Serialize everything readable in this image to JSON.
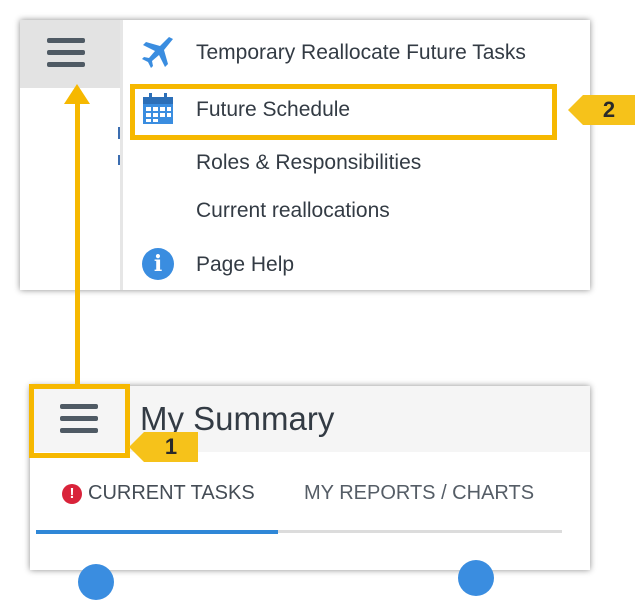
{
  "top_menu": {
    "items": [
      {
        "label": "Temporary Reallocate Future Tasks",
        "icon": "airplane-icon"
      },
      {
        "label": "Future Schedule",
        "icon": "calendar-icon"
      },
      {
        "label": "Roles & Responsibilities",
        "icon": ""
      },
      {
        "label": "Current reallocations",
        "icon": ""
      },
      {
        "label": "Page Help",
        "icon": "info-icon"
      }
    ],
    "info_glyph": "i"
  },
  "summary": {
    "title": "My Summary",
    "tabs": [
      {
        "label": "CURRENT TASKS",
        "active": true,
        "alert_glyph": "!"
      },
      {
        "label": "MY REPORTS / CHARTS",
        "active": false
      }
    ]
  },
  "callouts": {
    "step_1": "1",
    "step_2": "2"
  },
  "colors": {
    "highlight": "#f6b800",
    "accent_blue": "#2f87d7",
    "alert_red": "#d9233a",
    "text_dark": "#333b44"
  }
}
